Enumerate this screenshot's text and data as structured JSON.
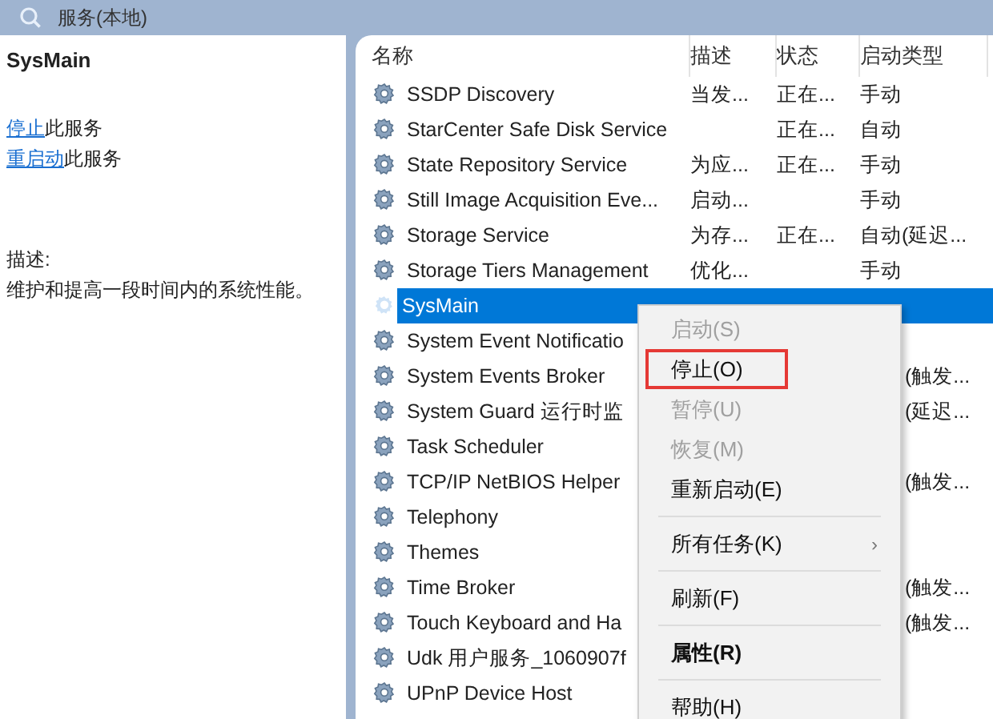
{
  "window": {
    "title": "服务(本地)"
  },
  "detail": {
    "title": "SysMain",
    "actions": [
      {
        "link": "停止",
        "text": "此服务"
      },
      {
        "link": "重启动",
        "text": "此服务"
      }
    ],
    "description_label": "描述:",
    "description": "维护和提高一段时间内的系统性能。"
  },
  "table": {
    "columns": [
      "名称",
      "描述",
      "状态",
      "启动类型"
    ],
    "rows": [
      {
        "name": "SSDP Discovery",
        "description": "当发...",
        "status": "正在...",
        "startup_type": "手动",
        "selected": false
      },
      {
        "name": "StarCenter Safe Disk Service",
        "status": "正在...",
        "startup_type": "自动",
        "selected": false
      },
      {
        "name": "State Repository Service",
        "description": "为应...",
        "status": "正在...",
        "startup_type": "手动",
        "selected": false
      },
      {
        "name": "Still Image Acquisition Eve...",
        "description": "启动...",
        "startup_type": "手动",
        "selected": false
      },
      {
        "name": "Storage Service",
        "description": "为存...",
        "status": "正在...",
        "startup_type": "自动(延迟...",
        "selected": false
      },
      {
        "name": "Storage Tiers Management",
        "description": "优化...",
        "startup_type": "手动",
        "selected": false
      },
      {
        "name": "SysMain",
        "selected": true
      },
      {
        "name": "System Event Notificatio",
        "selected": false
      },
      {
        "name": "System Events Broker",
        "startup_type": "(触发...",
        "selected": false
      },
      {
        "name": "System Guard 运行时监",
        "startup_type": "(延迟...",
        "selected": false
      },
      {
        "name": "Task Scheduler",
        "selected": false
      },
      {
        "name": "TCP/IP NetBIOS Helper",
        "startup_type": "(触发...",
        "selected": false
      },
      {
        "name": "Telephony",
        "selected": false
      },
      {
        "name": "Themes",
        "selected": false
      },
      {
        "name": "Time Broker",
        "startup_type": "(触发...",
        "selected": false
      },
      {
        "name": "Touch Keyboard and Ha",
        "startup_type": "(触发...",
        "selected": false
      },
      {
        "name": "Udk 用户服务_1060907f",
        "selected": false
      },
      {
        "name": "UPnP Device Host",
        "selected": false
      }
    ]
  },
  "context_menu": {
    "items": [
      {
        "kind": "item",
        "label": "启动(S)",
        "disabled": true,
        "highlighted": false,
        "default": false
      },
      {
        "kind": "item",
        "label": "停止(O)",
        "disabled": false,
        "highlighted": true,
        "default": false
      },
      {
        "kind": "item",
        "label": "暂停(U)",
        "disabled": true,
        "highlighted": false,
        "default": false
      },
      {
        "kind": "item",
        "label": "恢复(M)",
        "disabled": true,
        "highlighted": false,
        "default": false
      },
      {
        "kind": "item",
        "label": "重新启动(E)",
        "disabled": false,
        "highlighted": false,
        "default": false
      },
      {
        "kind": "separator"
      },
      {
        "kind": "item",
        "label": "所有任务(K)",
        "disabled": false,
        "highlighted": false,
        "default": false,
        "arrow": "›"
      },
      {
        "kind": "separator"
      },
      {
        "kind": "item",
        "label": "刷新(F)",
        "disabled": false,
        "highlighted": false,
        "default": false
      },
      {
        "kind": "separator"
      },
      {
        "kind": "item",
        "label": "属性(R)",
        "disabled": false,
        "highlighted": false,
        "default": true
      },
      {
        "kind": "separator"
      },
      {
        "kind": "item",
        "label": "帮助(H)",
        "disabled": false,
        "highlighted": false,
        "default": false
      }
    ]
  }
}
